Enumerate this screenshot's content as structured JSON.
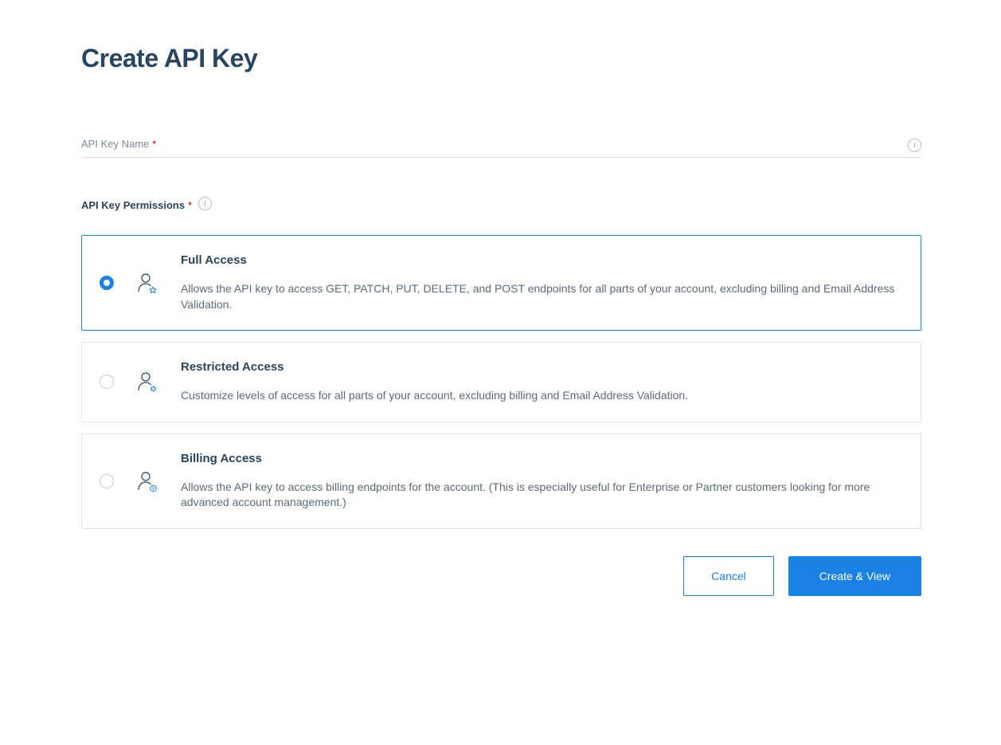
{
  "page": {
    "title": "Create API Key"
  },
  "fields": {
    "name_label": "API Key Name",
    "name_value": "",
    "permissions_label": "API Key Permissions"
  },
  "options": {
    "full": {
      "title": "Full Access",
      "desc": "Allows the API key to access GET, PATCH, PUT, DELETE, and POST endpoints for all parts of your account, excluding billing and Email Address Validation."
    },
    "restricted": {
      "title": "Restricted Access",
      "desc": "Customize levels of access for all parts of your account, excluding billing and Email Address Validation."
    },
    "billing": {
      "title": "Billing Access",
      "desc": "Allows the API key to access billing endpoints for the account. (This is especially useful for Enterprise or Partner customers looking for more advanced account management.)"
    }
  },
  "buttons": {
    "cancel": "Cancel",
    "create": "Create & View"
  }
}
